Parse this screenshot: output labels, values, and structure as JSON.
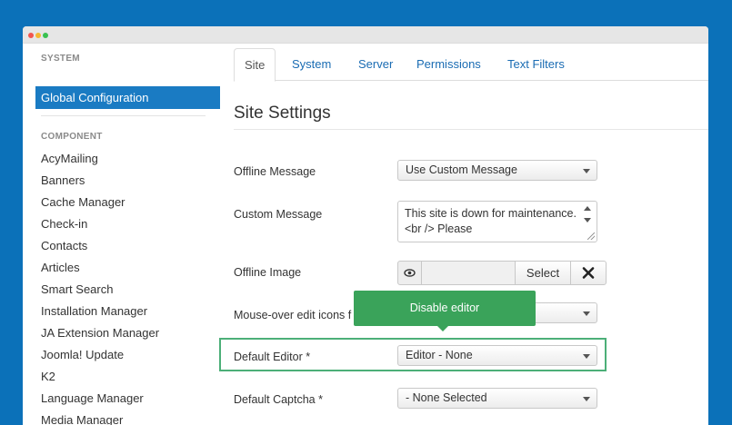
{
  "sidebar": {
    "system_heading": "SYSTEM",
    "active_item": "Global Configuration",
    "component_heading": "COMPONENT",
    "items": [
      "AcyMailing",
      "Banners",
      "Cache Manager",
      "Check-in",
      "Contacts",
      "Articles",
      "Smart Search",
      "Installation Manager",
      "JA Extension Manager",
      "Joomla! Update",
      "K2",
      "Language Manager",
      "Media Manager"
    ]
  },
  "tabs": [
    "Site",
    "System",
    "Server",
    "Permissions",
    "Text Filters"
  ],
  "section_title": "Site Settings",
  "form": {
    "offline_message": {
      "label": "Offline Message",
      "value": "Use Custom Message"
    },
    "custom_message": {
      "label": "Custom Message",
      "value": "This site is down for maintenance.<br /> Please"
    },
    "offline_image": {
      "label": "Offline Image",
      "select_label": "Select"
    },
    "mouseover": {
      "label": "Mouse-over edit icons f"
    },
    "default_editor": {
      "label": "Default Editor *",
      "value": "Editor - None"
    },
    "default_captcha": {
      "label": "Default Captcha *",
      "value": "- None Selected"
    }
  },
  "tooltip": {
    "text": "Disable editor"
  },
  "colors": {
    "background": "#0b71b9",
    "active_nav": "#1a7bc3",
    "tooltip": "#3aa35a",
    "highlight": "#4caf78"
  }
}
